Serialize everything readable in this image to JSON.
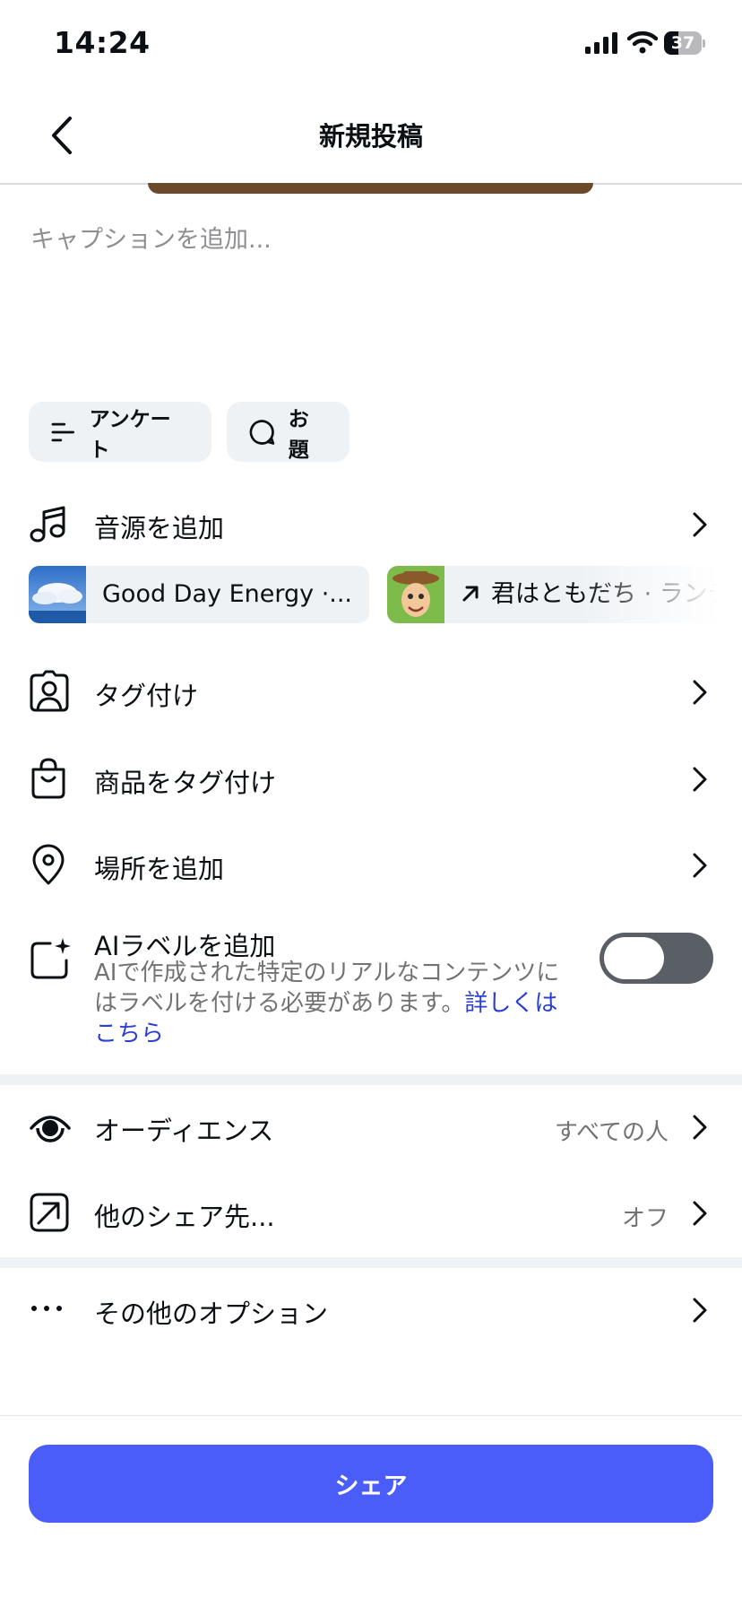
{
  "status_bar": {
    "time": "14:24",
    "battery": "37",
    "battery_level": 0.37
  },
  "nav": {
    "title": "新規投稿",
    "back_icon": "chevron-left-icon"
  },
  "caption": {
    "placeholder": "キャプションを追加..."
  },
  "chips": [
    {
      "label": "アンケート",
      "icon": "poll-icon"
    },
    {
      "label": "お題",
      "icon": "prompt-bubble-icon"
    }
  ],
  "music": {
    "label": "音源を追加",
    "suggestions": [
      {
        "text": "Good Day Energy ·..."
      },
      {
        "text": "君はともだち · ランディ"
      }
    ]
  },
  "options": {
    "tag_people": "タグ付け",
    "tag_products": "商品をタグ付け",
    "add_location": "場所を追加"
  },
  "ai_label": {
    "title": "AIラベルを追加",
    "description": "AIで作成された特定のリアルなコンテンツにはラベルを付ける必要があります。",
    "link": "詳しくはこちら",
    "toggle_on": false
  },
  "audience": {
    "label": "オーディエンス",
    "value": "すべての人"
  },
  "share_to": {
    "label": "他のシェア先...",
    "value": "オフ"
  },
  "more_options": {
    "label": "その他のオプション"
  },
  "share_button": {
    "label": "シェア"
  },
  "colors": {
    "accent": "#4a5df9",
    "link": "#2b3fd1",
    "toggle_off": "#5a5f66",
    "chip_bg": "#eff2f5"
  }
}
